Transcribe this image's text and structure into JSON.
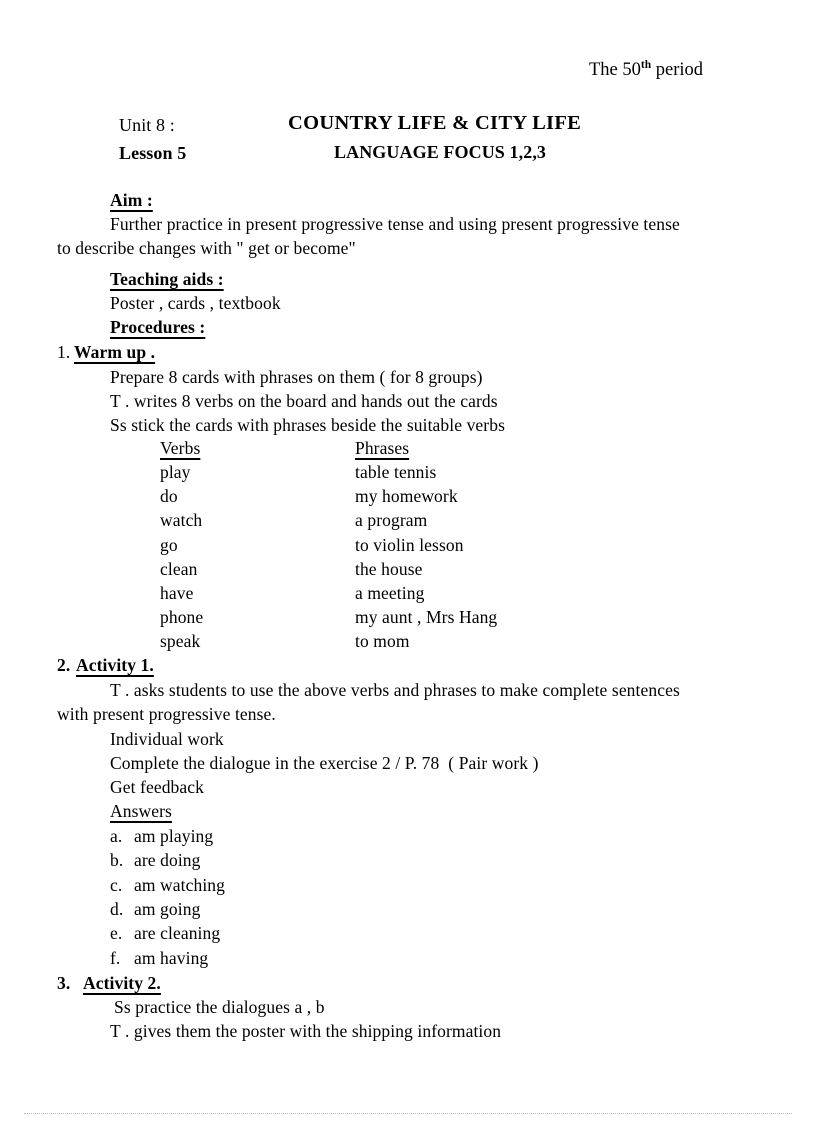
{
  "document": {
    "header_right": {
      "prefix": "The 50",
      "superscript": "th",
      "suffix": " period"
    },
    "title_block": {
      "unit": "Unit 8 :",
      "lesson": "Lesson 5",
      "main_title": "COUNTRY LIFE & CITY LIFE",
      "sub_title": "LANGUAGE FOCUS 1,2,3"
    },
    "aim": {
      "heading": "Aim :",
      "line1": "Further practice in present progressive tense and using present progressive tense",
      "line2": "to describe changes with \" get or become\""
    },
    "teaching_aids": {
      "heading": "Teaching aids :",
      "line1": "Poster , cards , textbook"
    },
    "procedures": {
      "heading": "Procedures :"
    },
    "warm_up": {
      "number": "1.",
      "heading": "Warm up .",
      "lines": [
        "Prepare 8 cards with phrases on them ( for 8 groups)",
        "T . writes 8 verbs on the board and hands out the cards",
        "Ss stick the cards with phrases beside the suitable verbs"
      ],
      "table": {
        "headers": [
          "Verbs",
          "Phrases"
        ],
        "rows": [
          [
            "play",
            "table tennis"
          ],
          [
            "do",
            "my homework"
          ],
          [
            "watch",
            "a program"
          ],
          [
            "go",
            "to violin lesson"
          ],
          [
            "clean",
            "the house"
          ],
          [
            "have",
            "a meeting"
          ],
          [
            "phone",
            "my aunt , Mrs Hang"
          ],
          [
            "speak",
            "to mom"
          ]
        ]
      }
    },
    "activity_1": {
      "number": "2.",
      "heading": "Activity 1.",
      "line1": "T . asks students to use the above verbs and phrases to make complete sentences",
      "line2": "with present progressive tense.",
      "lines": [
        "Individual work",
        "Complete the dialogue in the exercise 2 / P. 78  ( Pair work )",
        "Get feedback"
      ],
      "answers_heading": "Answers",
      "answers": [
        {
          "letter": "a.",
          "text": "am playing"
        },
        {
          "letter": "b.",
          "text": "are doing"
        },
        {
          "letter": "c.",
          "text": "am watching"
        },
        {
          "letter": "d.",
          "text": "am going"
        },
        {
          "letter": "e.",
          "text": "are cleaning"
        },
        {
          "letter": "f.",
          "text": "am having"
        }
      ]
    },
    "activity_2": {
      "number": "3.",
      "heading": "Activity 2.",
      "lines": [
        "Ss practice the dialogues a , b",
        "T . gives them the poster with the shipping information"
      ]
    }
  }
}
